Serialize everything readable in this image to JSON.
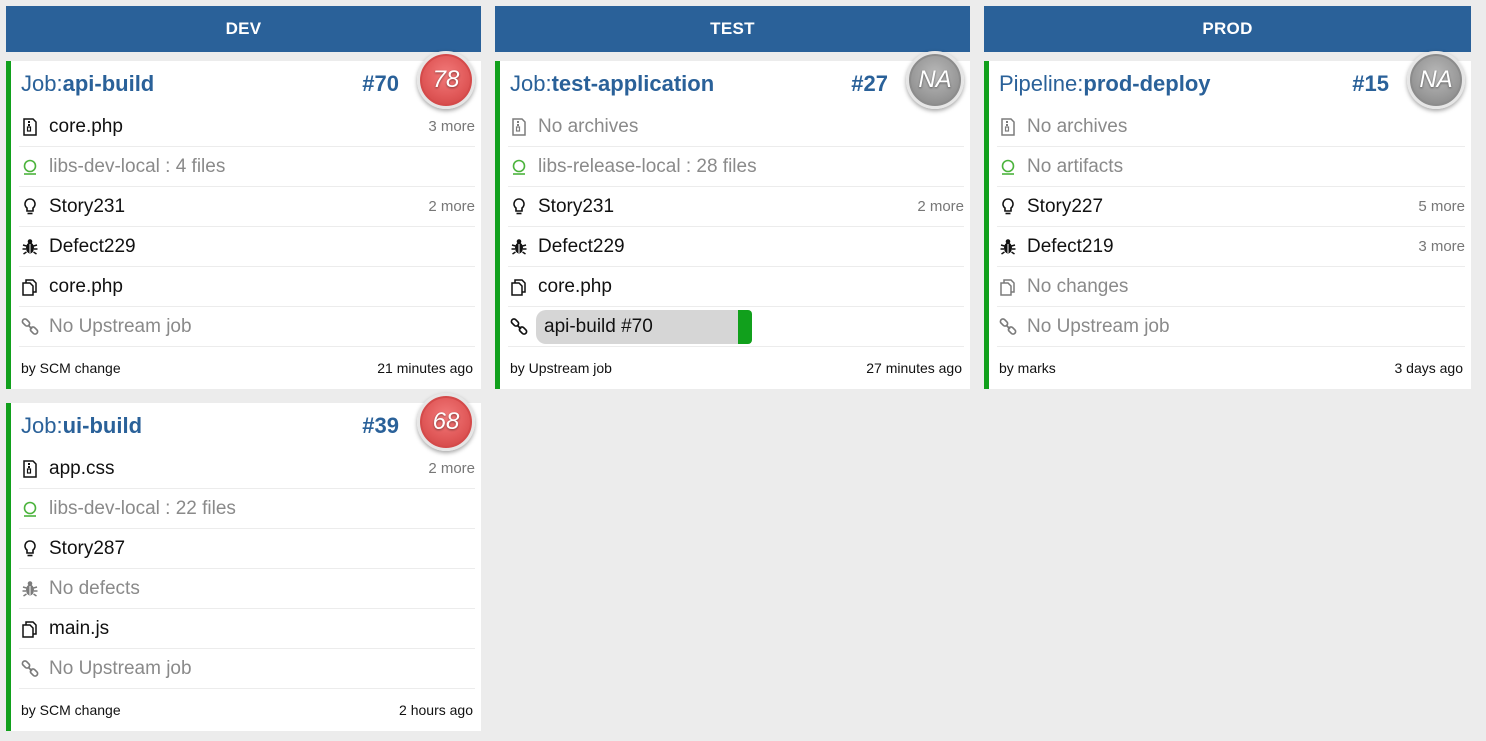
{
  "columns": [
    {
      "title": "DEV",
      "cards": [
        {
          "kind": "Job:",
          "name": "api-build",
          "number": "#70",
          "badge": "78",
          "rows": [
            {
              "icon": "archive-icon",
              "text": "core.php",
              "more": "3 more"
            },
            {
              "icon": "artifact-ring-icon",
              "text": "libs-dev-local : 4 files",
              "more": ""
            },
            {
              "icon": "lightbulb-icon",
              "text": "Story231",
              "more": "2 more"
            },
            {
              "icon": "bug-icon",
              "text": "Defect229",
              "more": ""
            },
            {
              "icon": "changes-icon",
              "text": "core.php",
              "more": ""
            },
            {
              "icon": "link-icon",
              "text": "No Upstream job",
              "more": ""
            }
          ],
          "footer_by": "by SCM change",
          "footer_ago": "21 minutes ago"
        },
        {
          "kind": "Job:",
          "name": "ui-build",
          "number": "#39",
          "badge": "68",
          "rows": [
            {
              "icon": "archive-icon",
              "text": "app.css",
              "more": "2 more"
            },
            {
              "icon": "artifact-ring-icon",
              "text": "libs-dev-local : 22 files",
              "more": ""
            },
            {
              "icon": "lightbulb-icon",
              "text": "Story287",
              "more": ""
            },
            {
              "icon": "bug-icon",
              "text": "No defects",
              "more": ""
            },
            {
              "icon": "changes-icon",
              "text": "main.js",
              "more": ""
            },
            {
              "icon": "link-icon",
              "text": "No Upstream job",
              "more": ""
            }
          ],
          "footer_by": "by SCM change",
          "footer_ago": "2 hours ago"
        }
      ]
    },
    {
      "title": "TEST",
      "cards": [
        {
          "kind": "Job:",
          "name": "test-application",
          "number": "#27",
          "badge": "NA",
          "rows": [
            {
              "icon": "archive-icon",
              "text": "No archives",
              "more": ""
            },
            {
              "icon": "artifact-ring-icon",
              "text": "libs-release-local : 28 files",
              "more": ""
            },
            {
              "icon": "lightbulb-icon",
              "text": "Story231",
              "more": "2 more"
            },
            {
              "icon": "bug-icon",
              "text": "Defect229",
              "more": ""
            },
            {
              "icon": "changes-icon",
              "text": "core.php",
              "more": ""
            },
            {
              "icon": "link-icon",
              "text": "api-build #70",
              "more": ""
            }
          ],
          "footer_by": "by Upstream job",
          "footer_ago": "27 minutes ago"
        }
      ]
    },
    {
      "title": "PROD",
      "cards": [
        {
          "kind": "Pipeline:",
          "name": "prod-deploy",
          "number": "#15",
          "badge": "NA",
          "rows": [
            {
              "icon": "archive-icon",
              "text": "No archives",
              "more": ""
            },
            {
              "icon": "artifact-ring-icon",
              "text": "No artifacts",
              "more": ""
            },
            {
              "icon": "lightbulb-icon",
              "text": "Story227",
              "more": "5 more"
            },
            {
              "icon": "bug-icon",
              "text": "Defect219",
              "more": "3 more"
            },
            {
              "icon": "changes-icon",
              "text": "No changes",
              "more": ""
            },
            {
              "icon": "link-icon",
              "text": "No Upstream job",
              "more": ""
            }
          ],
          "footer_by": "by marks",
          "footer_ago": "3 days ago"
        }
      ]
    }
  ],
  "colors": {
    "header_blue": "#2a6199",
    "success_green": "#11a01c",
    "badge_red": "#e05858",
    "badge_gray": "#9a9a9a"
  }
}
